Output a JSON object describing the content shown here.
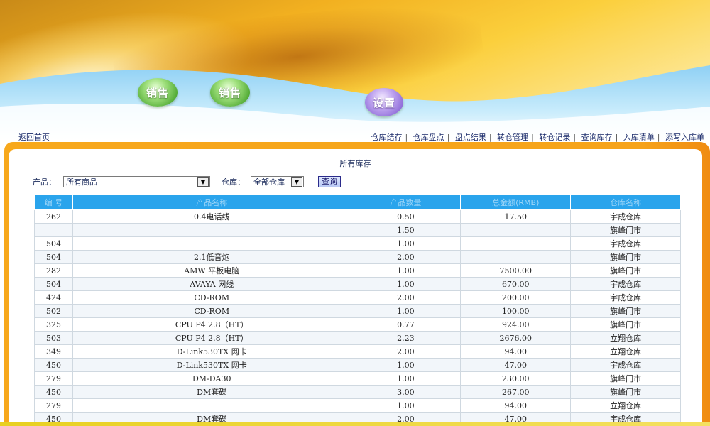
{
  "menu": {
    "button1": "销售",
    "button2": "销售",
    "button3": "设置"
  },
  "nav": {
    "back_home": "返回首页",
    "links": [
      "仓库结存",
      "仓库盘点",
      "盘点结果",
      "转仓管理",
      "转仓记录",
      "查询库存",
      "入库清单",
      "添写入库单"
    ]
  },
  "page": {
    "title": "所有库存"
  },
  "filter": {
    "product_label": "产品：",
    "product_value": "所有商品",
    "warehouse_label": "仓库：",
    "warehouse_value": "全部仓库",
    "query_button": "查询"
  },
  "table": {
    "headers": [
      "编 号",
      "产品名称",
      "产品数量",
      "总金额(RMB)",
      "仓库名称"
    ],
    "rows": [
      [
        "262",
        "0.4电话线",
        "0.50",
        "17.50",
        "宇成仓库"
      ],
      [
        "",
        "",
        "1.50",
        "",
        "旗峰门市"
      ],
      [
        "504",
        "",
        "1.00",
        "",
        "宇成仓库"
      ],
      [
        "504",
        "2.1低音炮",
        "2.00",
        "",
        "旗峰门市"
      ],
      [
        "282",
        "AMW 平板电脑",
        "1.00",
        "7500.00",
        "旗峰门市"
      ],
      [
        "504",
        "AVAYA 网线",
        "1.00",
        "670.00",
        "宇成仓库"
      ],
      [
        "424",
        "CD-ROM",
        "2.00",
        "200.00",
        "宇成仓库"
      ],
      [
        "502",
        "CD-ROM",
        "1.00",
        "100.00",
        "旗峰门市"
      ],
      [
        "325",
        "CPU P4 2.8（HT）",
        "0.77",
        "924.00",
        "旗峰门市"
      ],
      [
        "503",
        "CPU P4 2.8（HT）",
        "2.23",
        "2676.00",
        "立翔仓库"
      ],
      [
        "349",
        "D-Link530TX 网卡",
        "2.00",
        "94.00",
        "立翔仓库"
      ],
      [
        "450",
        "D-Link530TX 网卡",
        "1.00",
        "47.00",
        "宇成仓库"
      ],
      [
        "279",
        "DM-DA30",
        "1.00",
        "230.00",
        "旗峰门市"
      ],
      [
        "450",
        "DM套碟",
        "3.00",
        "267.00",
        "旗峰门市"
      ],
      [
        "279",
        "",
        "1.00",
        "94.00",
        "立翔仓库"
      ],
      [
        "450",
        "DM套碟",
        "2.00",
        "47.00",
        "宇成仓库"
      ]
    ]
  },
  "colors": {
    "header_bg": "#2aa4ec",
    "frame": "#f7a81c"
  }
}
